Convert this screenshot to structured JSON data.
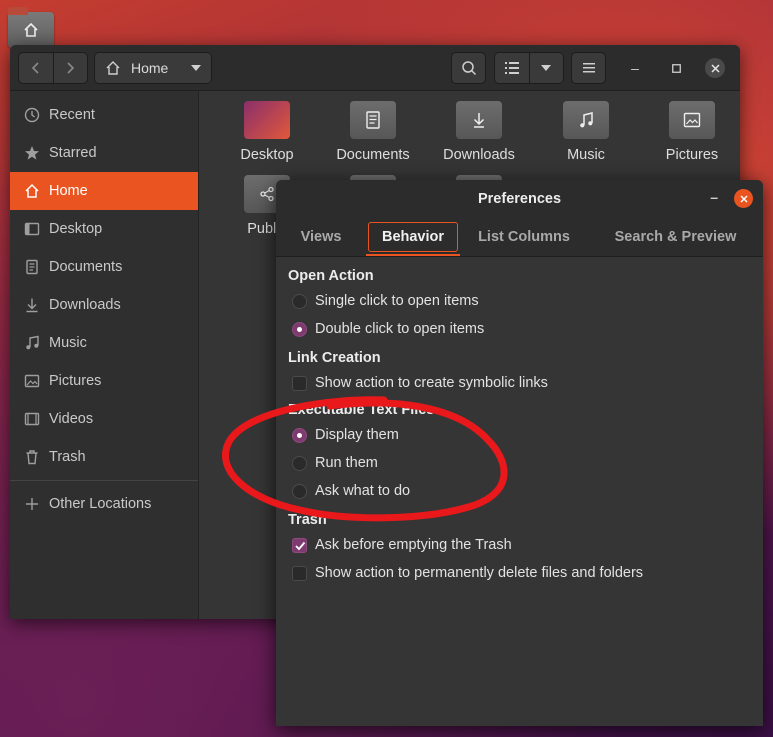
{
  "file_manager": {
    "path_label": "Home",
    "sidebar": {
      "items": [
        {
          "label": "Recent",
          "icon": "clock-icon"
        },
        {
          "label": "Starred",
          "icon": "star-icon"
        },
        {
          "label": "Home",
          "icon": "home-icon",
          "active": true
        },
        {
          "label": "Desktop",
          "icon": "desktop-icon"
        },
        {
          "label": "Documents",
          "icon": "document-icon"
        },
        {
          "label": "Downloads",
          "icon": "download-icon"
        },
        {
          "label": "Music",
          "icon": "music-icon"
        },
        {
          "label": "Pictures",
          "icon": "picture-icon"
        },
        {
          "label": "Videos",
          "icon": "video-icon"
        },
        {
          "label": "Trash",
          "icon": "trash-icon"
        }
      ],
      "other_locations": "Other Locations"
    },
    "folders": [
      {
        "label": "Desktop"
      },
      {
        "label": "Documents"
      },
      {
        "label": "Downloads"
      },
      {
        "label": "Music"
      },
      {
        "label": "Pictures"
      },
      {
        "label": "Public"
      }
    ]
  },
  "preferences": {
    "title": "Preferences",
    "tabs": [
      "Views",
      "Behavior",
      "List Columns",
      "Search & Preview"
    ],
    "active_tab": "Behavior",
    "sections": {
      "open_action": {
        "heading": "Open Action",
        "options": [
          "Single click to open items",
          "Double click to open items"
        ],
        "selected": 1
      },
      "link_creation": {
        "heading": "Link Creation",
        "option": "Show action to create symbolic links",
        "checked": false
      },
      "executable": {
        "heading": "Executable Text Files",
        "options": [
          "Display them",
          "Run them",
          "Ask what to do"
        ],
        "selected": 0
      },
      "trash": {
        "heading": "Trash",
        "options": [
          "Ask before emptying the Trash",
          "Show action to permanently delete files and folders"
        ],
        "checked": [
          true,
          false
        ]
      }
    }
  },
  "colors": {
    "accent": "#e95420",
    "radio_selected": "#7d3b6f",
    "annotation": "#e8181b"
  }
}
